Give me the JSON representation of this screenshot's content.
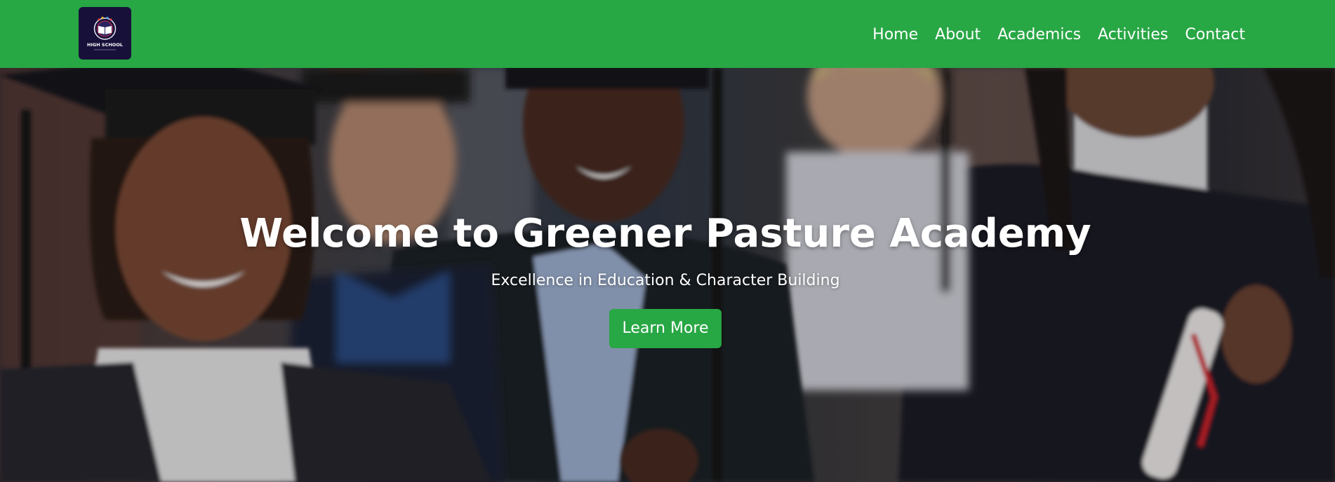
{
  "brand": {
    "logo_icon": "school-book-crest-icon",
    "logo_text": "HIGH SCHOOL",
    "colors": {
      "primary": "#28a745",
      "logo_bg": "#17113a",
      "text": "#ffffff"
    }
  },
  "nav": {
    "items": [
      {
        "label": "Home"
      },
      {
        "label": "About"
      },
      {
        "label": "Academics"
      },
      {
        "label": "Activities"
      },
      {
        "label": "Contact"
      }
    ]
  },
  "hero": {
    "title": "Welcome to Greener Pasture Academy",
    "subtitle": "Excellence in Education & Character Building",
    "button_label": "Learn More"
  }
}
